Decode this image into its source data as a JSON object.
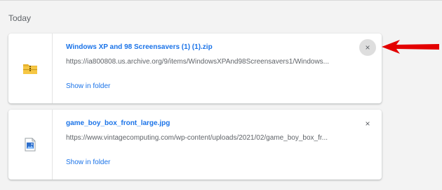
{
  "section": {
    "title": "Today"
  },
  "downloads": [
    {
      "file_name": "Windows XP and 98 Screensavers (1) (1).zip",
      "url": "https://ia800808.us.archive.org/9/items/WindowsXPAnd98Screensavers1/Windows...",
      "folder_link": "Show in folder",
      "close_label": "×",
      "file_icon": "zip-folder-icon"
    },
    {
      "file_name": "game_boy_box_front_large.jpg",
      "url": "https://www.vintagecomputing.com/wp-content/uploads/2021/02/game_boy_box_fr...",
      "folder_link": "Show in folder",
      "close_label": "×",
      "file_icon": "image-file-icon"
    }
  ],
  "annotation": {
    "arrow_icon": "red-arrow-pointer-icon",
    "color": "#e30000"
  },
  "colors": {
    "link": "#1a73e8",
    "secondary_text": "#5f6368",
    "background": "#f3f3f3"
  }
}
